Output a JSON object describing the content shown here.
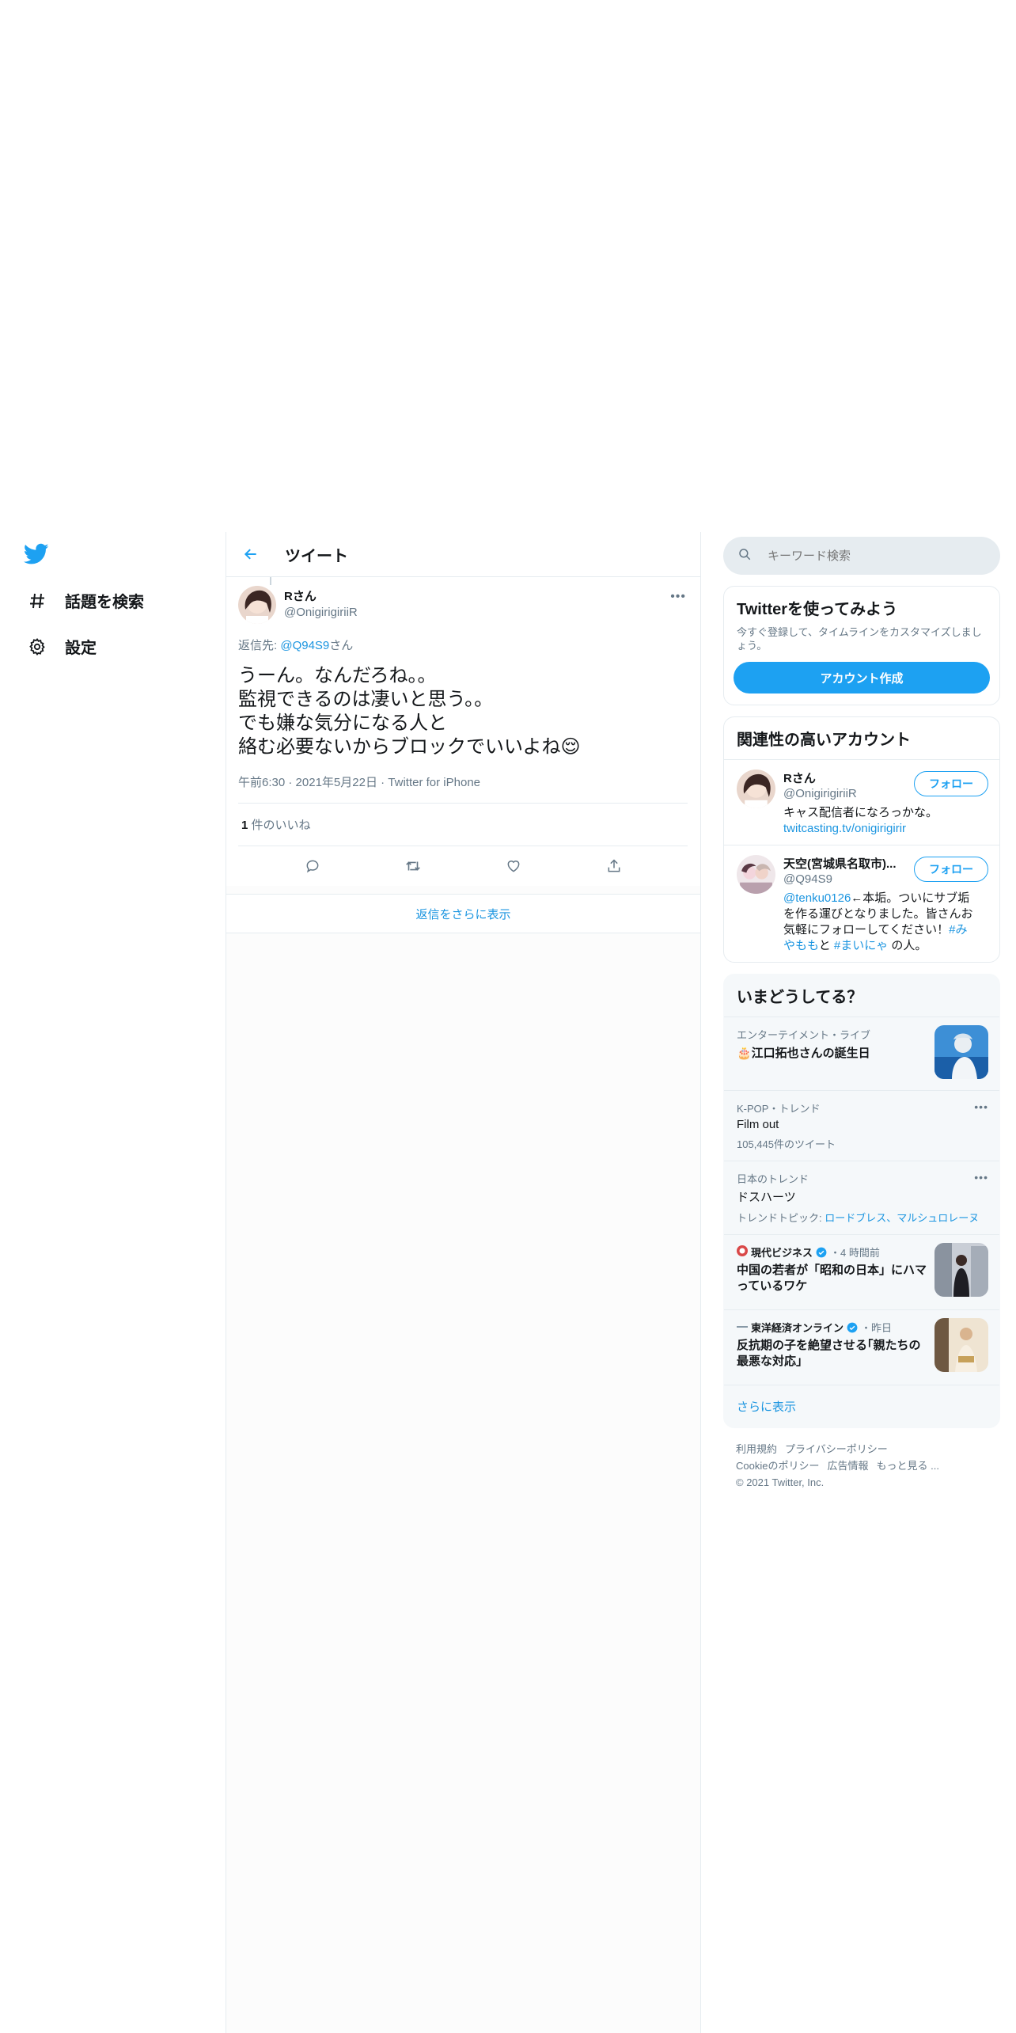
{
  "nav": {
    "explore_label": "話題を検索",
    "settings_label": "設定"
  },
  "header": {
    "title": "ツイート"
  },
  "tweet": {
    "name": "Rさん",
    "handle": "@OnigirigiriiR",
    "reply_prefix": "返信先: ",
    "reply_user": "@Q94S9",
    "reply_suffix": "さん",
    "lines": [
      "うーん。なんだろね。。",
      "監視できるのは凄いと思う。。",
      "でも嫌な気分になる人と",
      "絡む必要ないからブロックでいいよね"
    ],
    "emoji": "😌",
    "time": "午前6:30",
    "date": "2021年5月22日",
    "source": "Twitter for iPhone",
    "likes_count": "1",
    "likes_label": "件のいいね",
    "show_more_replies": "返信をさらに表示"
  },
  "search": {
    "placeholder": "キーワード検索"
  },
  "signup": {
    "title": "Twitterを使ってみよう",
    "desc": "今すぐ登録して、タイムラインをカスタマイズしましょう。",
    "button": "アカウント作成"
  },
  "related": {
    "title": "関連性の高いアカウント",
    "follow_label": "フォロー",
    "accounts": [
      {
        "name": "Rさん",
        "handle": "@OnigirigiriiR",
        "bio_text": "キャス配信者になろっかな。",
        "bio_link": "twitcasting.tv/onigirigirir"
      },
      {
        "name": "天空(宮城県名取市)...",
        "handle": "@Q94S9",
        "bio_mention": "@tenku0126",
        "bio_text1": "←本垢。ついにサブ垢を作る運びとなりました。皆さんお気軽にフォローしてください！",
        "bio_tag1": "#みやもも",
        "bio_text2": "と",
        "bio_tag2": "#まいにゃ",
        "bio_text3": "の人。"
      }
    ]
  },
  "trends": {
    "title": "いまどうしてる？",
    "items": [
      {
        "context": "エンターテイメント・ライブ",
        "name": "🎂江口拓也さんの誕生日"
      },
      {
        "context": "K-POP・トレンド",
        "name": "Film out",
        "sub": "105,445件のツイート"
      },
      {
        "context": "日本のトレンド",
        "name": "ドスハーツ",
        "sub_label": "トレンドトピック: ",
        "sub_links": "ロードブレス、マルシュロレーヌ"
      }
    ],
    "news": [
      {
        "source": "現代ビジネス",
        "time": "・4 時間前",
        "title": "中国の若者が「昭和の日本」にハマっているワケ"
      },
      {
        "source": "東洋経済オンライン",
        "time": "・昨日",
        "title": "反抗期の子を絶望させる｢親たちの最悪な対応｣"
      }
    ],
    "show_more": "さらに表示"
  },
  "footer": {
    "links": [
      "利用規約",
      "プライバシーポリシー",
      "Cookieのポリシー",
      "広告情報",
      "もっと見る ..."
    ],
    "copyright": "© 2021 Twitter, Inc."
  },
  "colors": {
    "accent": "#1da1f2",
    "link": "#1b95e0",
    "muted": "#657786",
    "border": "#e6ecf0"
  }
}
